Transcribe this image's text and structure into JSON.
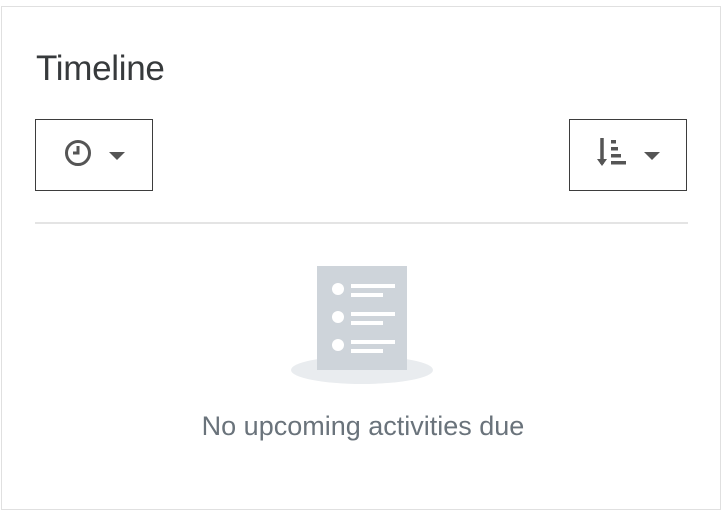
{
  "block": {
    "title": "Timeline"
  },
  "controls": {
    "filter_icon": "clock-icon",
    "sort_icon": "sort-icon"
  },
  "empty_state": {
    "illustration_icon": "empty-list-icon",
    "message": "No upcoming activities due"
  },
  "colors": {
    "text": "#373a3c",
    "muted_text": "#6a737b",
    "illustration": "#ced4da",
    "border": "#3d3d3d"
  }
}
